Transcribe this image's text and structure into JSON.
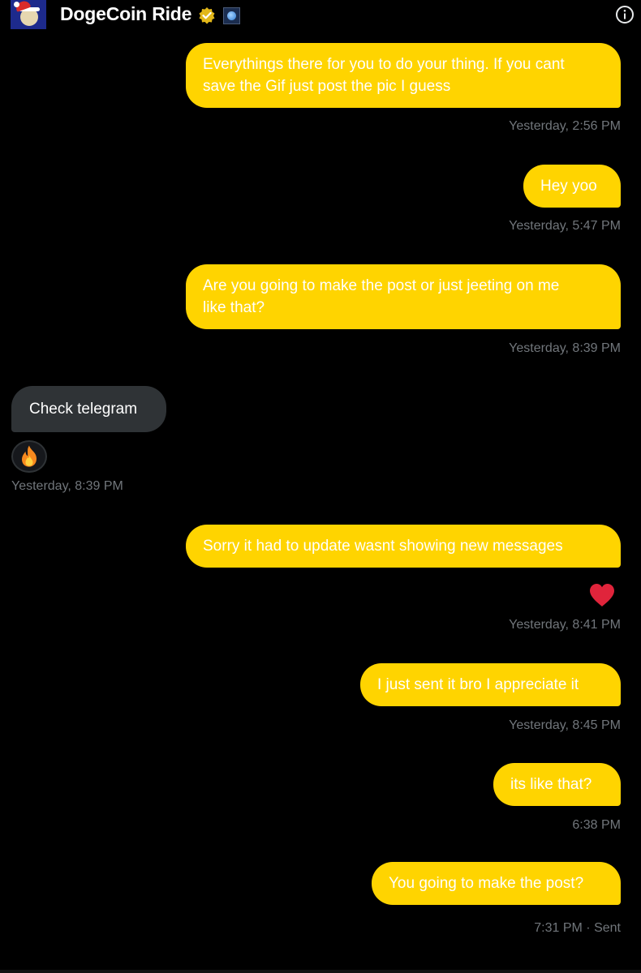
{
  "header": {
    "title": "DogeCoin Ride",
    "verified_icon": "verified-badge-icon",
    "org_icon": "globe-affiliate-icon",
    "info_icon": "info-icon"
  },
  "colors": {
    "outgoing_bubble": "#ffd400",
    "incoming_bubble": "#2f3336",
    "background": "#000000",
    "timestamp": "#71767b"
  },
  "messages": [
    {
      "direction": "out",
      "lines": [
        "Everythings there for you to do your thing. If you cant",
        "save the Gif just post the pic I guess"
      ],
      "timestamp": "Yesterday, 2:56 PM"
    },
    {
      "direction": "out",
      "lines": [
        "Hey yoo"
      ],
      "timestamp": "Yesterday, 5:47 PM"
    },
    {
      "direction": "out",
      "lines": [
        "Are you going to make the post or just jeeting on me",
        "like that?"
      ],
      "timestamp": "Yesterday, 8:39 PM"
    },
    {
      "direction": "in",
      "lines": [
        "Check telegram"
      ],
      "reaction": "fire-emoji",
      "timestamp": "Yesterday, 8:39 PM"
    },
    {
      "direction": "out",
      "lines": [
        "Sorry it had to update wasnt showing new messages"
      ],
      "reaction": "heart-emoji",
      "timestamp": "Yesterday, 8:41 PM"
    },
    {
      "direction": "out",
      "lines": [
        "I just sent it bro I appreciate it"
      ],
      "timestamp": "Yesterday, 8:45 PM"
    },
    {
      "direction": "out",
      "lines": [
        "its like that?"
      ],
      "timestamp": "6:38 PM"
    },
    {
      "direction": "out",
      "lines": [
        "You going to make the post?"
      ],
      "timestamp": "7:31 PM",
      "status": "Sent"
    }
  ]
}
